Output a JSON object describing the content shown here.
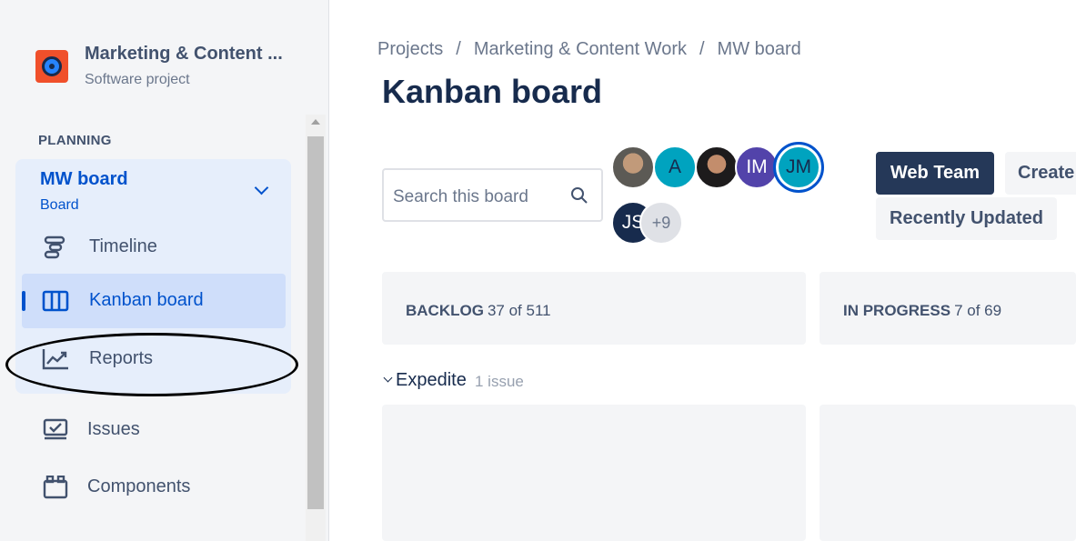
{
  "sidebar": {
    "project_name": "Marketing & Content ...",
    "project_type": "Software project",
    "section_label": "PLANNING",
    "board": {
      "title": "MW board",
      "subtitle": "Board"
    },
    "items": [
      {
        "label": "Timeline",
        "icon": "timeline-icon"
      },
      {
        "label": "Kanban board",
        "icon": "kanban-board-icon",
        "active": true
      },
      {
        "label": "Reports",
        "icon": "reports-icon"
      },
      {
        "label": "Issues",
        "icon": "issues-icon"
      },
      {
        "label": "Components",
        "icon": "components-icon"
      }
    ]
  },
  "breadcrumbs": [
    "Projects",
    "Marketing & Content Work",
    "MW board"
  ],
  "breadcrumb_separator": "/",
  "page_title": "Kanban board",
  "search": {
    "placeholder": "Search this board",
    "icon": "search-icon"
  },
  "avatars": {
    "initials": [
      "A",
      "IM",
      "JM",
      "JS"
    ],
    "more": "+9"
  },
  "buttons": {
    "web_team": "Web Team",
    "create": "Create",
    "recently_updated": "Recently Updated"
  },
  "columns": [
    {
      "name": "BACKLOG",
      "count": "37 of 511"
    },
    {
      "name": "IN PROGRESS",
      "count": "7 of 69"
    }
  ],
  "swimlane": {
    "name": "Expedite",
    "count": "1 issue"
  },
  "colors": {
    "accent": "#0052cc",
    "sidebar_bg": "#f4f5f7",
    "web_team_button": "#253858"
  }
}
